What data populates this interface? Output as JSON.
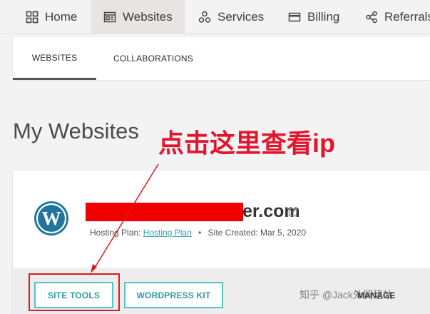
{
  "topnav": {
    "items": [
      {
        "label": "Home",
        "icon": "home-grid-icon"
      },
      {
        "label": "Websites",
        "icon": "website-icon"
      },
      {
        "label": "Services",
        "icon": "services-icon"
      },
      {
        "label": "Billing",
        "icon": "credit-card-icon"
      },
      {
        "label": "Referrals",
        "icon": "share-icon"
      }
    ],
    "active": "Websites"
  },
  "subtabs": [
    "WEBSITES",
    "COLLABORATIONS"
  ],
  "page_title": "My Websites",
  "annotation": "点击这里查看ip",
  "card": {
    "domain_suffix": "er.com",
    "hosting_plan_label": "Hosting Plan:",
    "hosting_plan_value": "Hosting Plan",
    "separator": "•",
    "site_created": "Site Created: Mar 5, 2020",
    "buttons": {
      "site_tools": "SITE TOOLS",
      "wordpress_kit": "WORDPRESS KIT",
      "manage": "MANAGE"
    }
  },
  "colors": {
    "accent": "#55c2c8",
    "annotation_red": "#e3142e",
    "redaction": "#f20000"
  },
  "watermark": "知乎 @Jack外贸建站"
}
